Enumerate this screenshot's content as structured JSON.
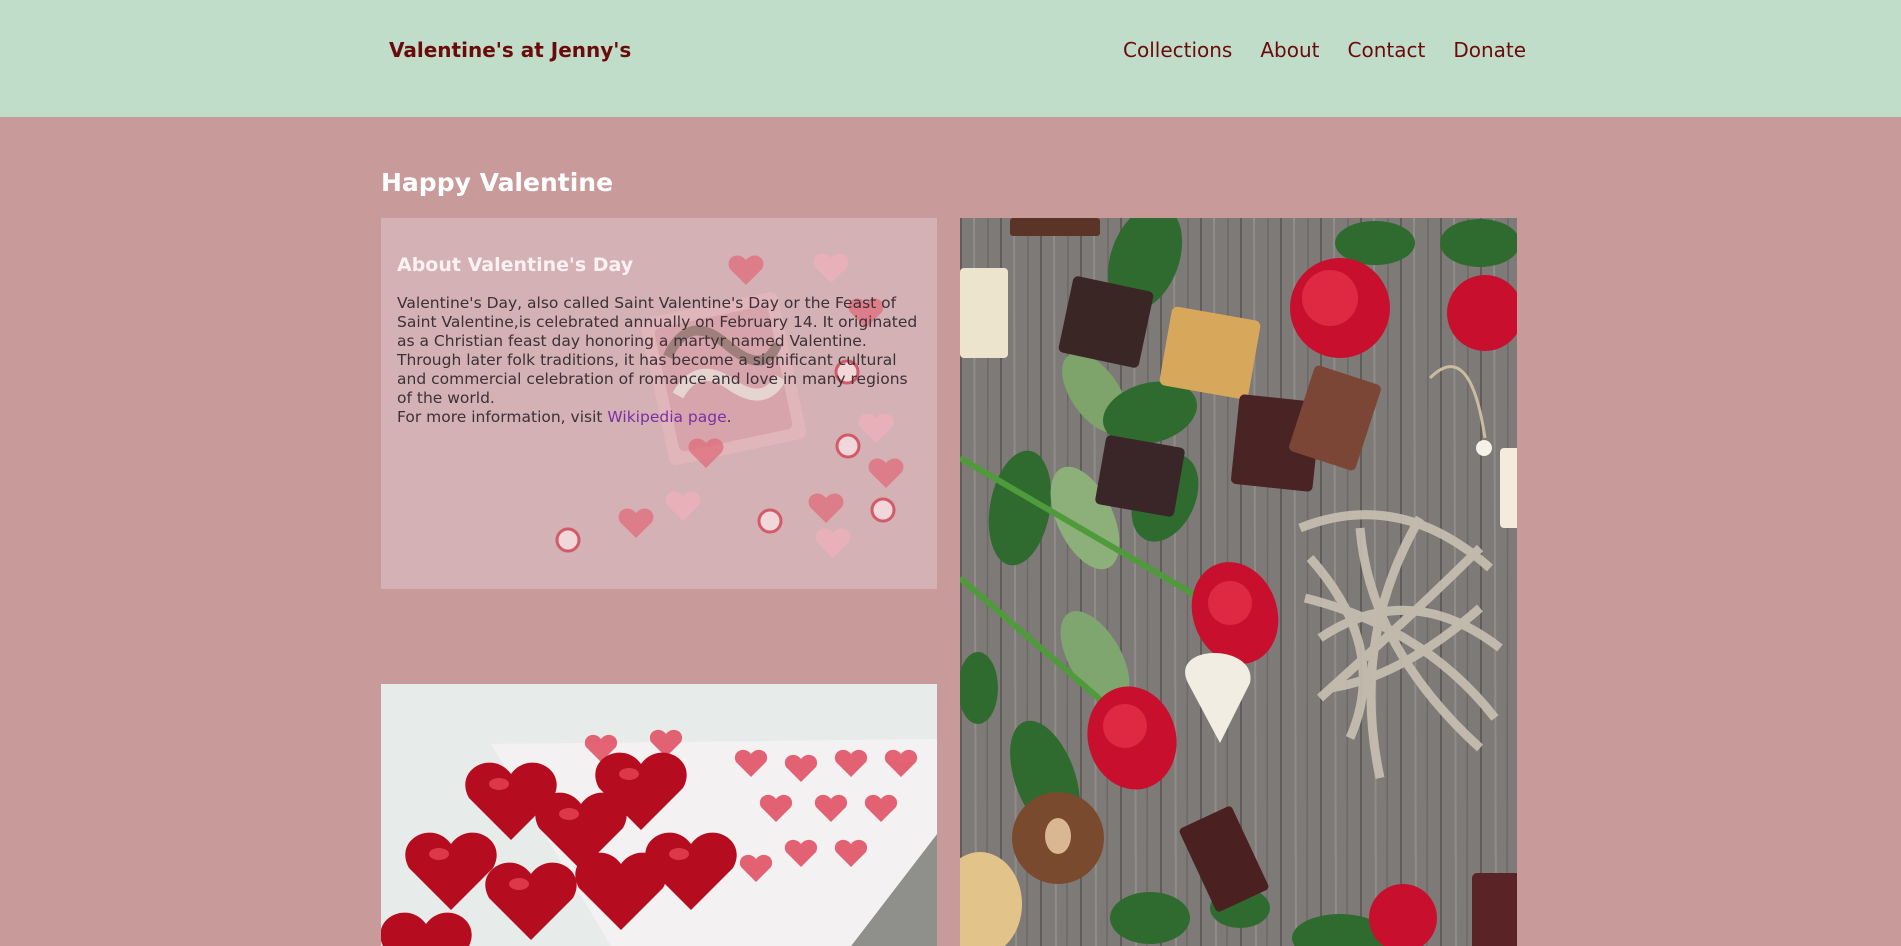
{
  "header": {
    "brand": "Valentine's at Jenny's",
    "nav": [
      "Collections",
      "About",
      "Contact",
      "Donate"
    ]
  },
  "main": {
    "title": "Happy Valentine",
    "about": {
      "heading": "About Valentine's Day",
      "body": "Valentine's Day, also called Saint Valentine's Day or the Feast of Saint Valentine,is celebrated annually on February 14. It originated as a Christian feast day honoring a martyr named Valentine. Through later folk traditions, it has become a significant cultural and commercial celebration of romance and love in many regions of the world.",
      "more_prefix": "For more information, visit ",
      "more_link": "Wikipedia page",
      "more_suffix": "."
    }
  },
  "colors": {
    "page_background": "#c89a9a",
    "header_background": "#c0ddca",
    "brand_text": "#6b0a0a",
    "link": "#7a2fa6"
  },
  "icons": {
    "roses_photo": "roses-and-chocolates-photo",
    "hearts_photo": "heart-chocolates-photo"
  }
}
